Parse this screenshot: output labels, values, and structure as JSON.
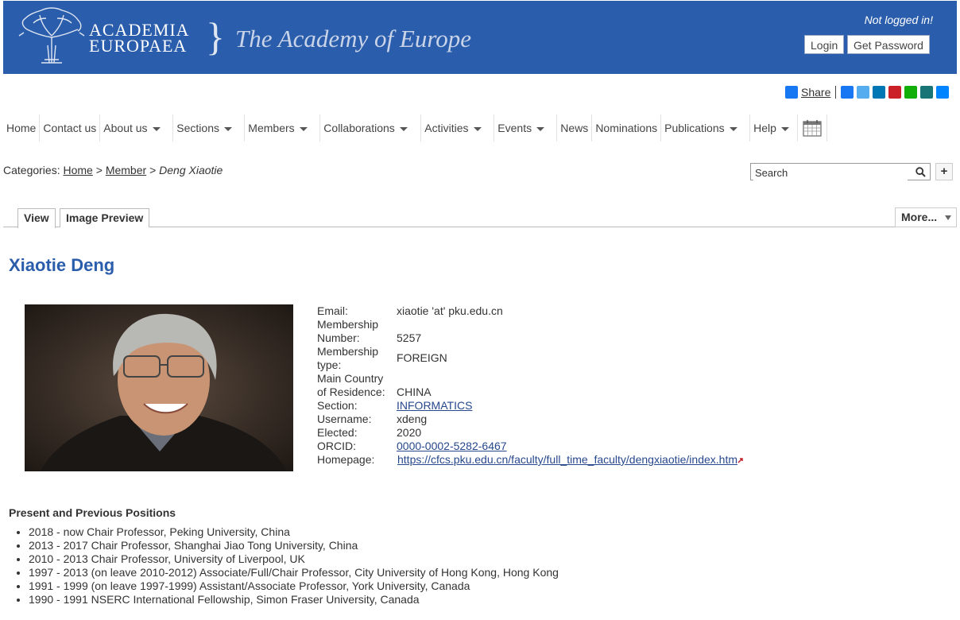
{
  "header": {
    "logo_line1": "ACADEMIA",
    "logo_line2": "EUROPAEA",
    "logo_brace": "}",
    "tagline": "The Academy of Europe",
    "status": "Not logged in!",
    "login_label": "Login",
    "get_password_label": "Get Password",
    "banner_color": "#2a5dab"
  },
  "share": {
    "label": "Share",
    "icons": [
      {
        "name": "facebook-share-icon",
        "color": "#1877f2"
      },
      {
        "name": "twitter-share-icon",
        "color": "#55acee"
      },
      {
        "name": "linkedin-share-icon",
        "color": "#0077b5"
      },
      {
        "name": "pinterest-share-icon",
        "color": "#cb2027"
      },
      {
        "name": "whatsapp-share-icon",
        "color": "#12af0a"
      },
      {
        "name": "xing-share-icon",
        "color": "#1a7576"
      },
      {
        "name": "messenger-share-icon",
        "color": "#0084ff"
      }
    ]
  },
  "nav": {
    "items": [
      {
        "label": "Home",
        "dropdown": false
      },
      {
        "label": "Contact us",
        "dropdown": false
      },
      {
        "label": "About us",
        "dropdown": true
      },
      {
        "label": "Sections",
        "dropdown": true
      },
      {
        "label": "Members",
        "dropdown": true
      },
      {
        "label": "Collaborations",
        "dropdown": true
      },
      {
        "label": "Activities",
        "dropdown": true
      },
      {
        "label": "Events",
        "dropdown": true
      },
      {
        "label": "News",
        "dropdown": false
      },
      {
        "label": "Nominations",
        "dropdown": false
      },
      {
        "label": "Publications",
        "dropdown": true
      },
      {
        "label": "Help",
        "dropdown": true
      }
    ],
    "calendar_icon": "calendar-icon"
  },
  "breadcrumb": {
    "prefix": "Categories:",
    "home": "Home",
    "sep1": ">",
    "member": "Member",
    "sep2": ">",
    "current": "Deng Xiaotie"
  },
  "search": {
    "placeholder": "Search",
    "plus": "+"
  },
  "tabs": {
    "view": "View",
    "image_preview": "Image Preview",
    "more": "More..."
  },
  "profile": {
    "name": "Xiaotie Deng",
    "fields": [
      {
        "label": "Email:",
        "value": "xiaotie 'at' pku.edu.cn"
      },
      {
        "label": "Membership Number:",
        "value": "5257"
      },
      {
        "label": "Membership type:",
        "value": "FOREIGN"
      },
      {
        "label": "Main Country of Residence:",
        "value": "CHINA"
      },
      {
        "label": "Section:",
        "value": "INFORMATICS"
      },
      {
        "label": "Username:",
        "value": "xdeng"
      },
      {
        "label": "Elected:",
        "value": "2020"
      },
      {
        "label": "ORCID:",
        "value": "0000-0002-5282-6467"
      },
      {
        "label": "Homepage:",
        "value": "https://cfcs.pku.edu.cn/faculty/full_time_faculty/dengxiaotie/index.htm"
      }
    ]
  },
  "positions": {
    "heading": "Present and Previous Positions",
    "items": [
      "2018 - now Chair Professor, Peking University, China",
      "2013 - 2017 Chair Professor, Shanghai Jiao Tong University, China",
      "2010 - 2013 Chair Professor, University of Liverpool, UK",
      "1997 - 2013 (on leave 2010-2012) Associate/Full/Chair Professor, City University of Hong Kong, Hong Kong",
      "1991 - 1999 (on leave 1997-1999) Assistant/Associate Professor, York University, Canada",
      "1990 - 1991 NSERC International Fellowship, Simon Fraser University, Canada"
    ]
  }
}
